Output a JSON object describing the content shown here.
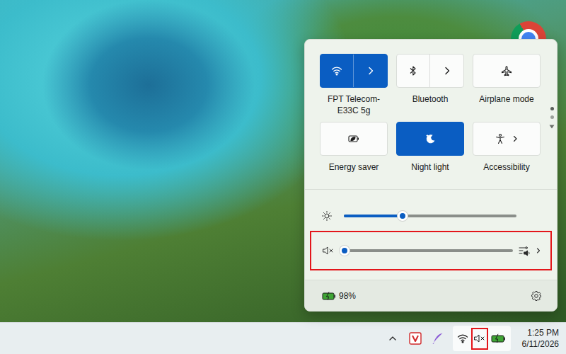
{
  "quick_settings": {
    "tiles": [
      {
        "label": "FPT Telecom-E33C 5g",
        "kind": "split",
        "on": true
      },
      {
        "label": "Bluetooth",
        "kind": "split",
        "on": false
      },
      {
        "label": "Airplane mode",
        "kind": "toggle",
        "on": false
      },
      {
        "label": "Energy saver",
        "kind": "toggle",
        "on": false
      },
      {
        "label": "Night light",
        "kind": "toggle",
        "on": true
      },
      {
        "label": "Accessibility",
        "kind": "chevron",
        "on": false
      }
    ],
    "page_dots": [
      {
        "selected": true
      },
      {
        "selected": false
      }
    ],
    "brightness": {
      "level": 0.34
    },
    "volume": {
      "muted": true,
      "level": 0.0,
      "highlighted": true
    },
    "battery": {
      "percent": "98%"
    }
  },
  "taskbar": {
    "volume_icon": {
      "muted": true,
      "highlighted": true
    },
    "clock": {
      "time": "1:25 PM",
      "date": "6/11/2026"
    }
  }
}
